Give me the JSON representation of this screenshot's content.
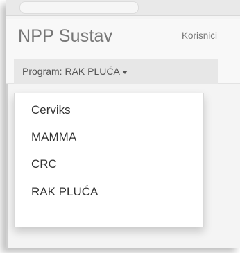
{
  "navbar": {
    "brand": "NPP Sustav",
    "links": [
      "Korisnici"
    ]
  },
  "program_dropdown": {
    "label": "Program: RAK PLUĆA",
    "selected": "RAK PLUĆA",
    "options": [
      "Cerviks",
      "MAMMA",
      "CRC",
      "RAK PLUĆA"
    ]
  }
}
